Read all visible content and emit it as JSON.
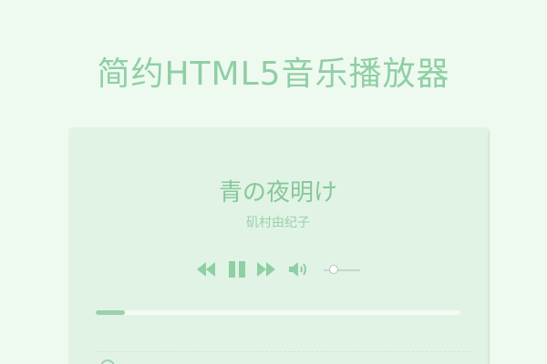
{
  "page": {
    "title": "简约HTML5音乐播放器"
  },
  "player": {
    "song_title": "青の夜明け",
    "artist": "矶村由纪子",
    "progress": 0.08,
    "volume": 0.28,
    "is_playing": true
  },
  "icons": {
    "prev": "prev-icon",
    "pause": "pause-icon",
    "next": "next-icon",
    "volume": "volume-icon",
    "playlist": "playlist-icon"
  },
  "colors": {
    "background": "#eefaf0",
    "card": "#e1f3e5",
    "accent": "#8fcfa4",
    "progress_fill": "#9bd1ad"
  }
}
